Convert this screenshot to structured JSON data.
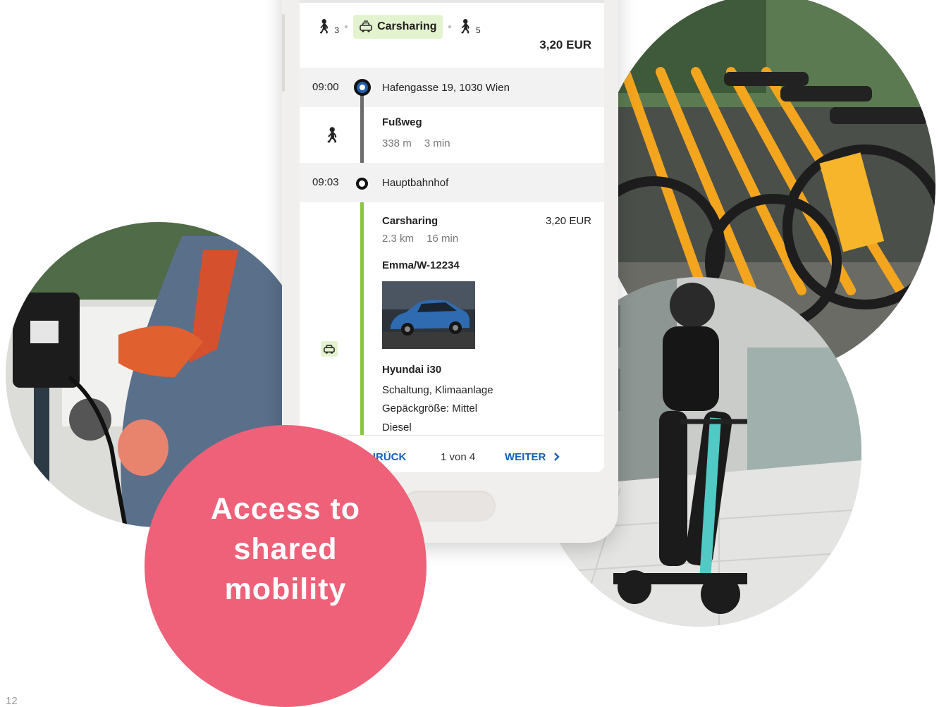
{
  "summary": {
    "walk_before": "3",
    "mode_label": "Carsharing",
    "walk_after": "5",
    "total_price": "3,20 EUR"
  },
  "timeline": {
    "start": {
      "time": "09:00",
      "place": "Hafengasse 19, 1030 Wien"
    },
    "walk": {
      "title": "Fußweg",
      "distance": "338 m",
      "duration": "3 min"
    },
    "mid": {
      "time": "09:03",
      "place": "Hauptbahnhof"
    },
    "carsharing": {
      "title": "Carsharing",
      "price": "3,20 EUR",
      "distance": "2.3 km",
      "duration": "16 min",
      "vehicle_id": "Emma/W-12234",
      "vehicle_model": "Hyundai i30",
      "features": "Schaltung, Klimaanlage",
      "luggage": "Gepäckgröße: Mittel",
      "fuel": "Diesel"
    }
  },
  "nav": {
    "back_label": "ZURÜCK",
    "page_indicator": "1 von 4",
    "next_label": "WEITER"
  },
  "bubble": {
    "text": "Access to shared mobility"
  },
  "page_number": "12",
  "icons": {
    "walk": "walking-person-icon",
    "car": "car-icon",
    "chevron": "chevron-right-icon"
  },
  "colors": {
    "accent_pink": "#ef6179",
    "carsharing_green": "#8cc63f",
    "chip_green": "#e3f3cf",
    "link_blue": "#1a5fb4",
    "start_dot_blue": "#1f5fb0"
  }
}
